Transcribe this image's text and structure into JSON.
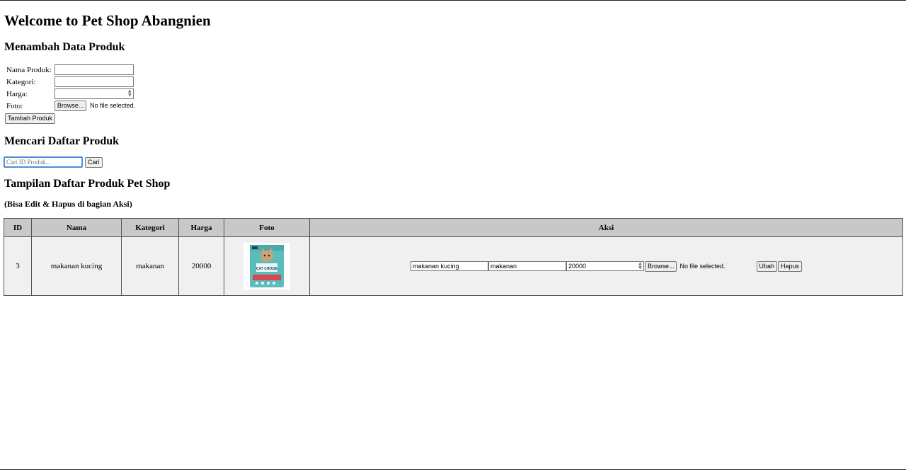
{
  "header": {
    "title": "Welcome to Pet Shop Abangnien"
  },
  "add_form": {
    "heading": "Menambah Data Produk",
    "name_label": "Nama Produk:",
    "category_label": "Kategori:",
    "price_label": "Harga:",
    "photo_label": "Foto:",
    "browse_label": "Browse...",
    "no_file_text": "No file selected.",
    "submit_label": "Tambah Produk"
  },
  "search": {
    "heading": "Mencari Daftar Produk",
    "placeholder": "Cari ID Produk...",
    "button_label": "Cari"
  },
  "list": {
    "heading": "Tampilan Daftar Produk Pet Shop",
    "note": "(Bisa Edit & Hapus di bagian Aksi)",
    "columns": [
      "ID",
      "Nama",
      "Kategori",
      "Harga",
      "Foto",
      "Aksi"
    ],
    "rows": [
      {
        "id": "3",
        "name": "makanan kucing",
        "category": "makanan",
        "price": "20000",
        "photo_brand": "CAT CHOIZE",
        "edit": {
          "name_value": "makanan kucing",
          "category_value": "makanan",
          "price_value": "20000",
          "browse_label": "Browse...",
          "no_file_text": "No file selected.",
          "update_label": "Ubah",
          "delete_label": "Hapus"
        }
      }
    ]
  },
  "colors": {
    "header_bg": "#c8c8c8",
    "row_bg": "#f0f0f0",
    "focus_border": "#4a90d9",
    "product_pack": "#5bbcbc"
  }
}
